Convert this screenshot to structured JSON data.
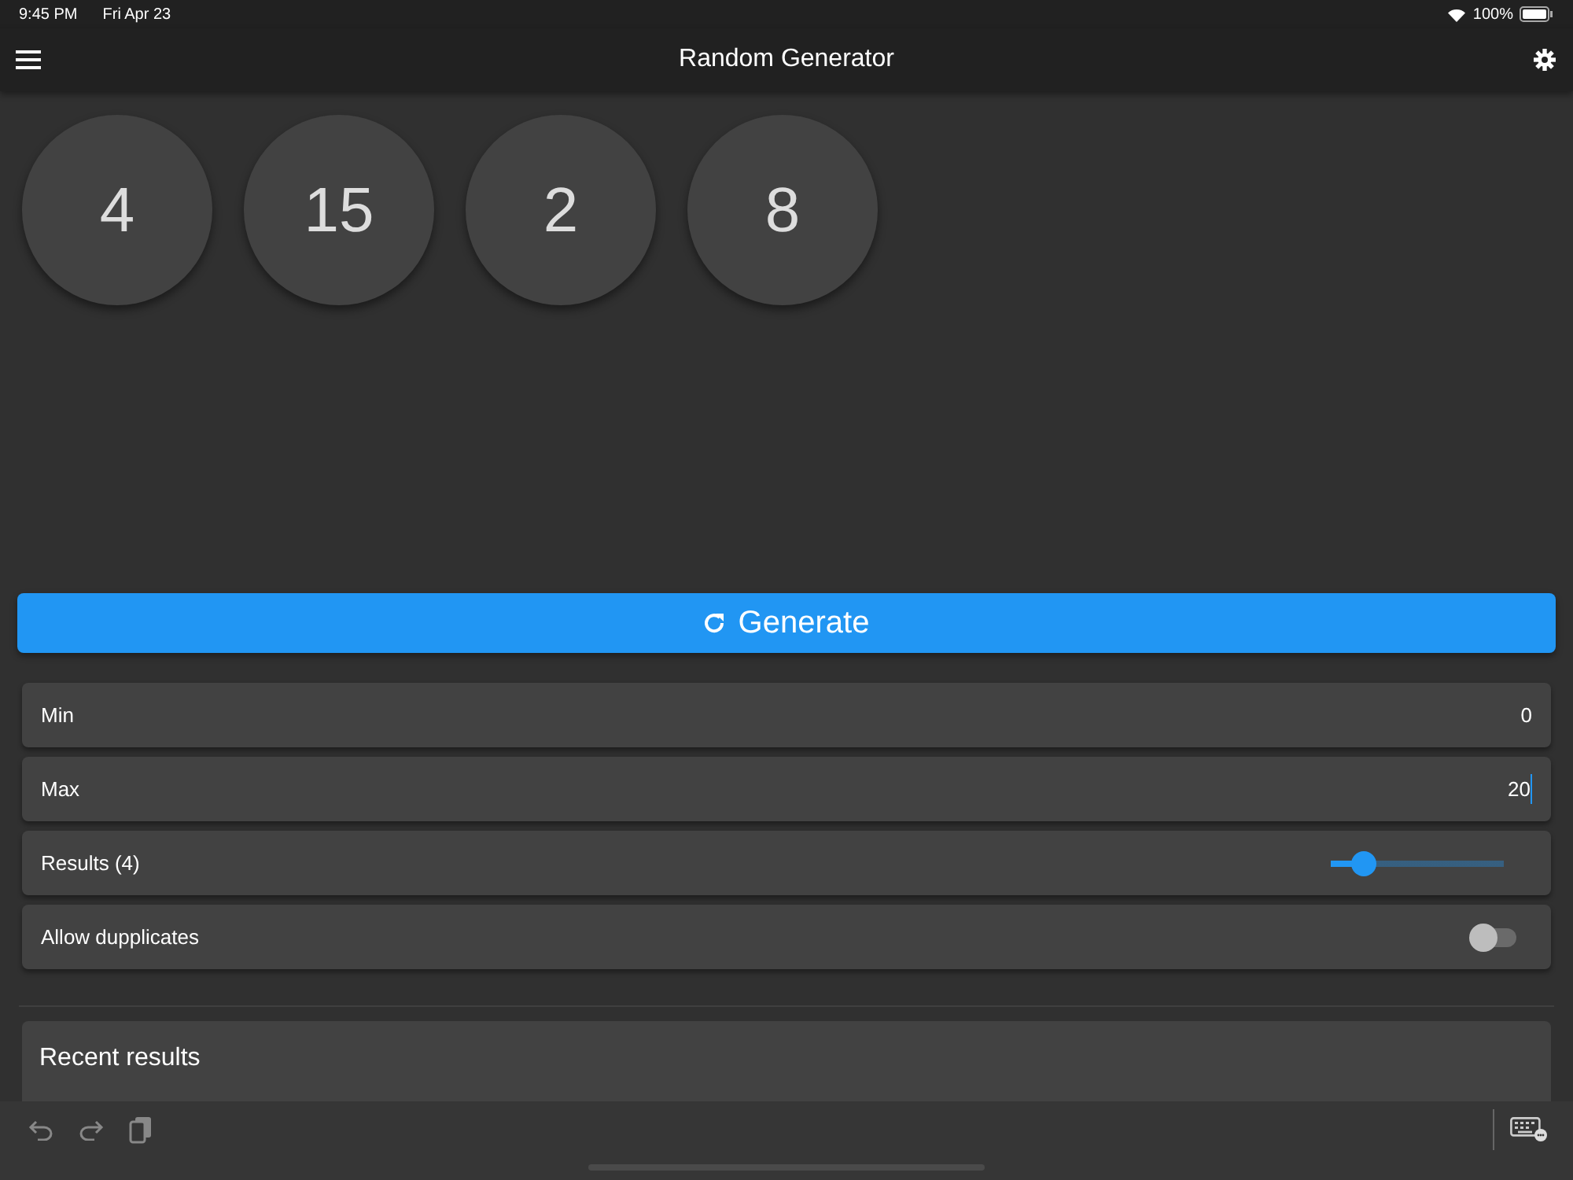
{
  "status_bar": {
    "time": "9:45 PM",
    "date": "Fri Apr 23",
    "battery": "100%"
  },
  "app_bar": {
    "title": "Random Generator"
  },
  "results": [
    "4",
    "15",
    "2",
    "8"
  ],
  "generate_button": {
    "label": "Generate"
  },
  "settings": [
    {
      "kind": "field",
      "label": "Min",
      "value": "0",
      "focused": false
    },
    {
      "kind": "field",
      "label": "Max",
      "value": "20",
      "focused": true
    },
    {
      "kind": "slider",
      "label": "Results (4)",
      "level": 0.19
    },
    {
      "kind": "switch",
      "label": "Allow dupplicates",
      "on": false
    }
  ],
  "recent_results": {
    "title": "Recent results"
  }
}
